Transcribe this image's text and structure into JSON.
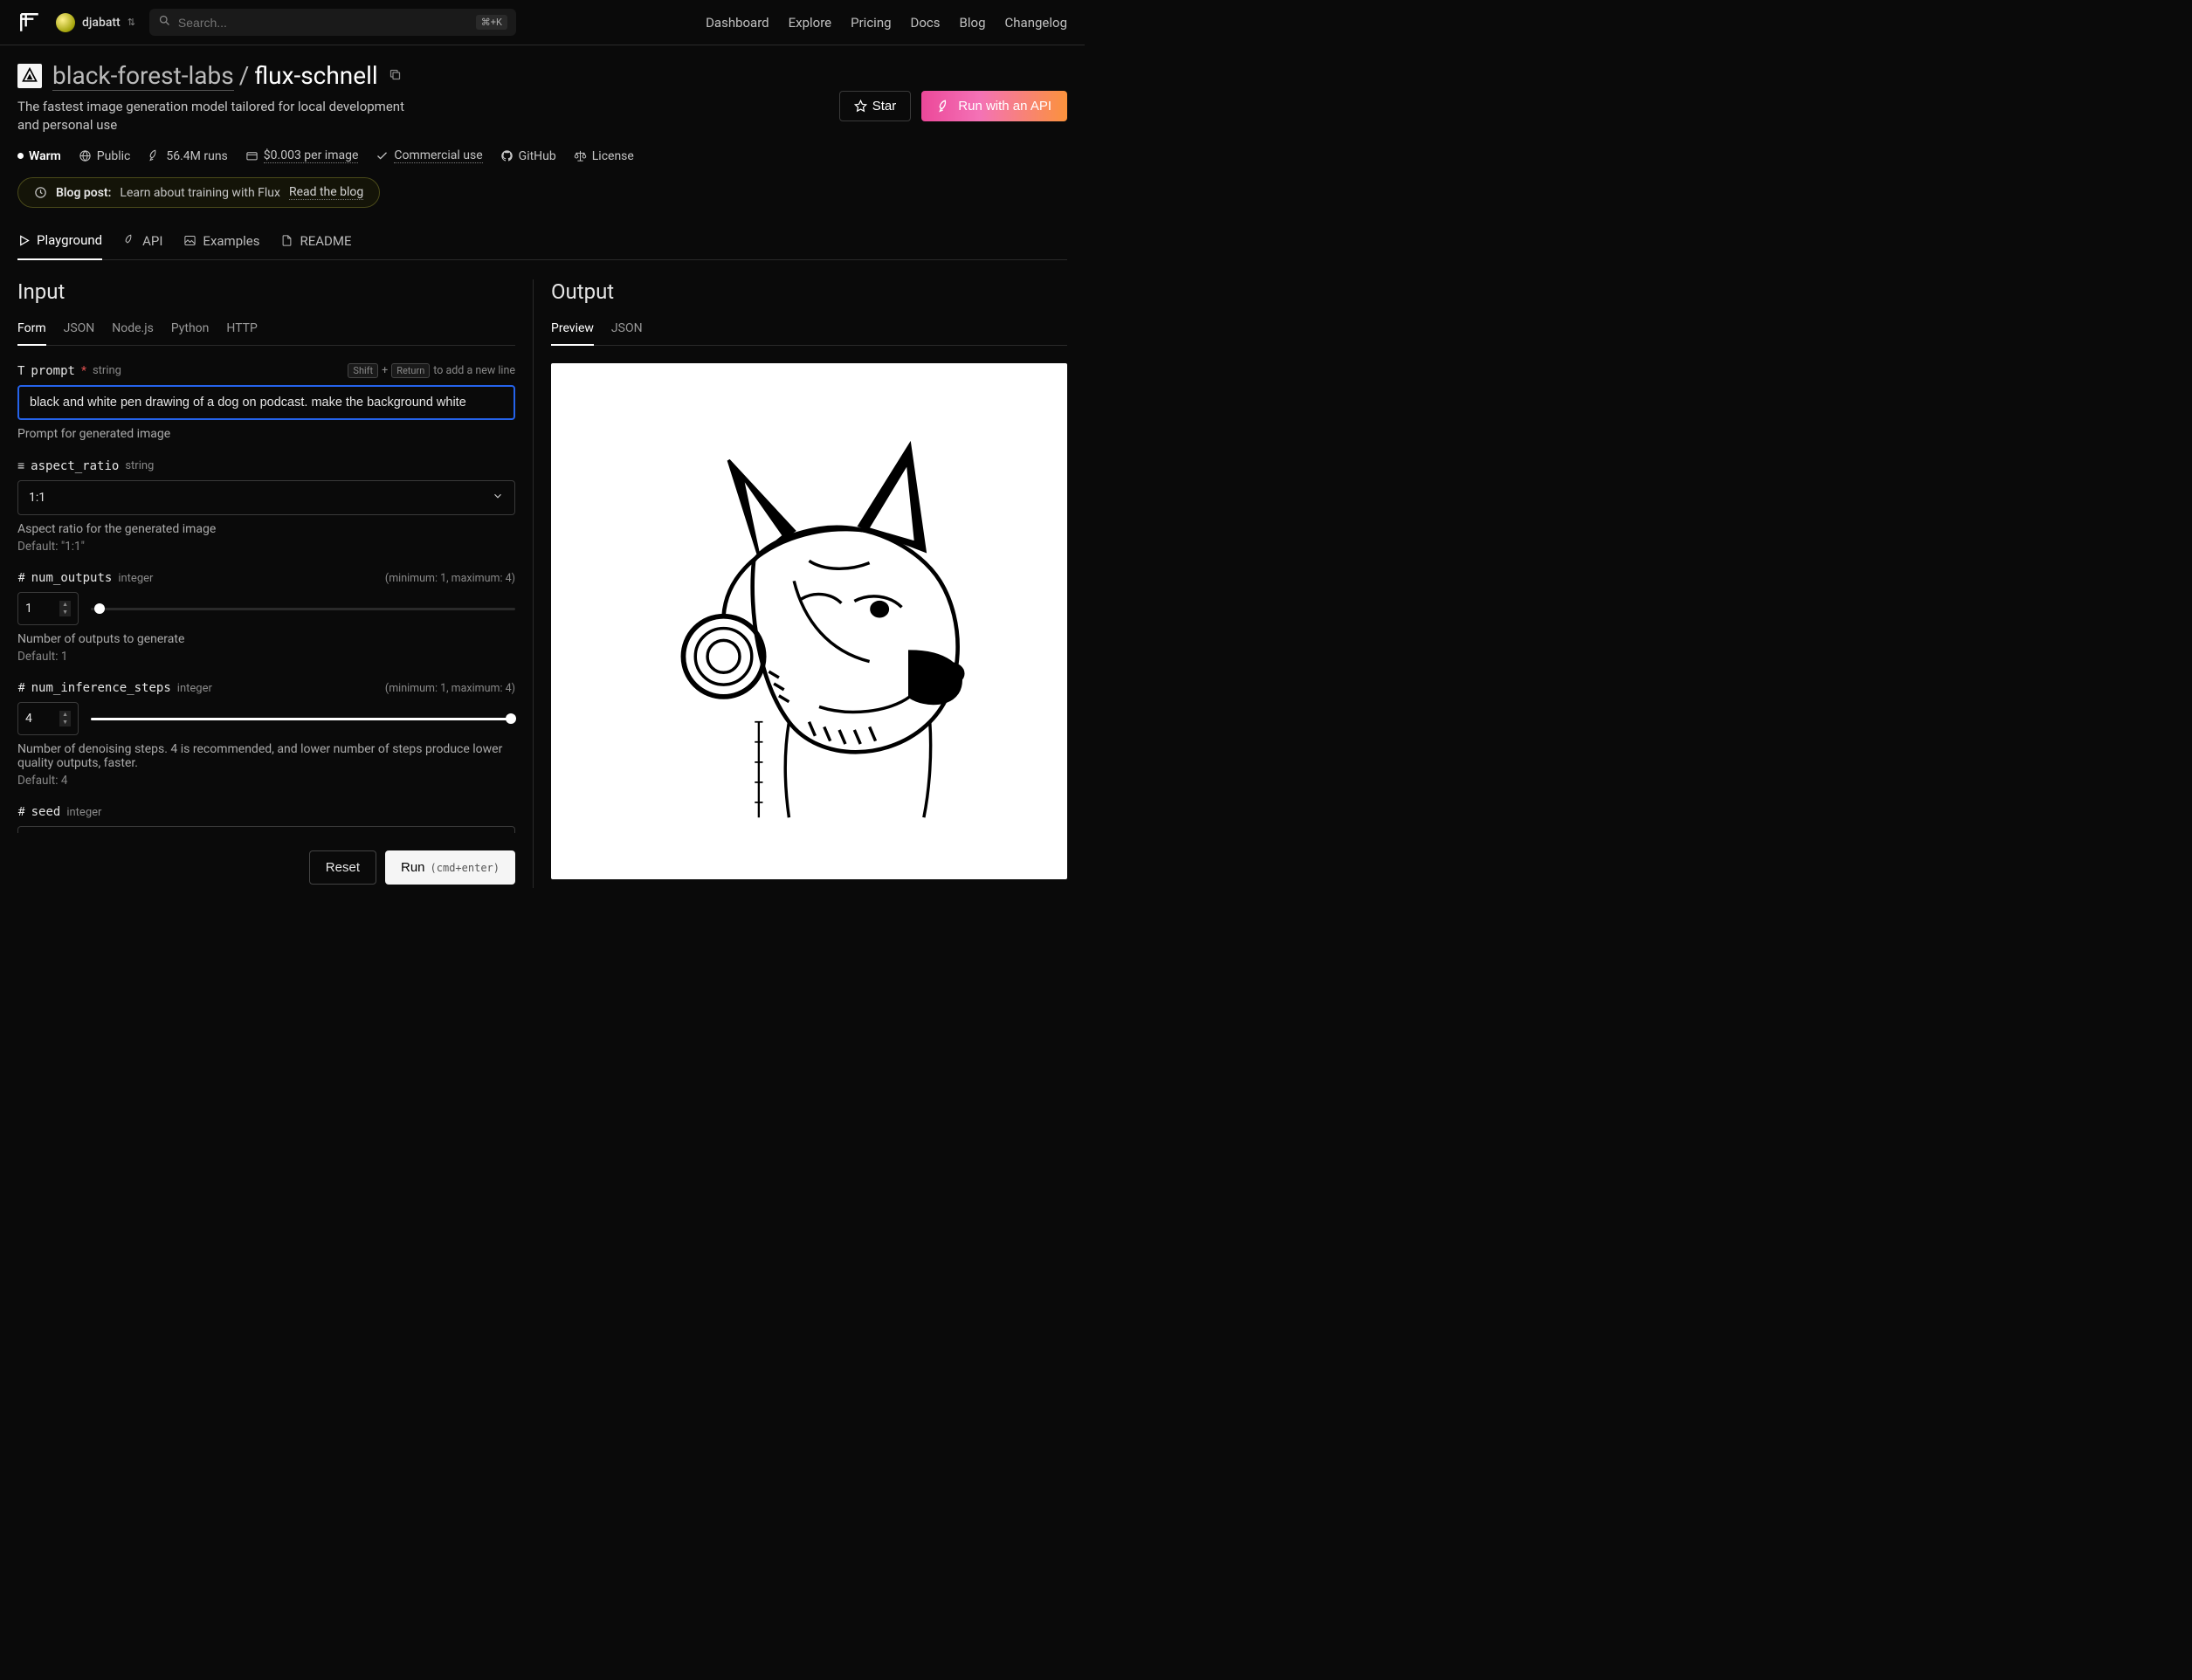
{
  "header": {
    "username": "djabatt",
    "search_placeholder": "Search...",
    "search_kbd": "⌘+K",
    "nav": [
      "Dashboard",
      "Explore",
      "Pricing",
      "Docs",
      "Blog",
      "Changelog"
    ]
  },
  "model": {
    "org": "black-forest-labs",
    "name": "flux-schnell",
    "subtitle": "The fastest image generation model tailored for local development and personal use",
    "star_label": "Star",
    "run_api_label": "Run with an API",
    "meta": {
      "warm": "Warm",
      "visibility": "Public",
      "runs": "56.4M runs",
      "price": "$0.003 per image",
      "commercial": "Commercial use",
      "github": "GitHub",
      "license": "License"
    },
    "blog": {
      "label": "Blog post:",
      "text": "Learn about training with Flux",
      "link": "Read the blog"
    }
  },
  "tabs": {
    "main": [
      "Playground",
      "API",
      "Examples",
      "README"
    ],
    "input": [
      "Form",
      "JSON",
      "Node.js",
      "Python",
      "HTTP"
    ],
    "output": [
      "Preview",
      "JSON"
    ]
  },
  "sections": {
    "input_title": "Input",
    "output_title": "Output"
  },
  "form": {
    "prompt": {
      "name": "prompt",
      "type": "string",
      "value": "black and white pen drawing of a dog on podcast. make the background white",
      "desc": "Prompt for generated image",
      "hint_shift": "Shift",
      "hint_plus": "+",
      "hint_return": "Return",
      "hint_rest": "to add a new line"
    },
    "aspect_ratio": {
      "name": "aspect_ratio",
      "type": "string",
      "value": "1:1",
      "desc": "Aspect ratio for the generated image",
      "default": "Default: \"1:1\""
    },
    "num_outputs": {
      "name": "num_outputs",
      "type": "integer",
      "value": "1",
      "range": "(minimum: 1, maximum: 4)",
      "desc": "Number of outputs to generate",
      "default": "Default: 1",
      "slider_pct": 0
    },
    "num_inference_steps": {
      "name": "num_inference_steps",
      "type": "integer",
      "value": "4",
      "range": "(minimum: 1, maximum: 4)",
      "desc": "Number of denoising steps. 4 is recommended, and lower number of steps produce lower quality outputs, faster.",
      "default": "Default: 4",
      "slider_pct": 100
    },
    "seed": {
      "name": "seed",
      "type": "integer"
    }
  },
  "actions": {
    "reset": "Reset",
    "run": "Run",
    "run_shortcut": "(cmd+enter)"
  }
}
